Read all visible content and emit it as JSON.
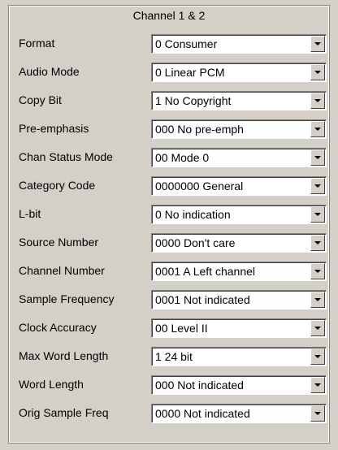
{
  "panel": {
    "title": "Channel 1 & 2",
    "rows": [
      {
        "label": "Format",
        "value": "0  Consumer"
      },
      {
        "label": "Audio Mode",
        "value": "0  Linear PCM"
      },
      {
        "label": "Copy Bit",
        "value": "1  No Copyright"
      },
      {
        "label": "Pre-emphasis",
        "value": "000  No pre-emph"
      },
      {
        "label": "Chan Status Mode",
        "value": "00  Mode 0"
      },
      {
        "label": "Category Code",
        "value": "0000000  General"
      },
      {
        "label": "L-bit",
        "value": "0  No indication"
      },
      {
        "label": "Source Number",
        "value": "0000  Don't care"
      },
      {
        "label": "Channel Number",
        "value": "0001  A Left channel"
      },
      {
        "label": "Sample Frequency",
        "value": "0001  Not indicated"
      },
      {
        "label": "Clock Accuracy",
        "value": "00  Level II"
      },
      {
        "label": "Max Word Length",
        "value": "1  24 bit"
      },
      {
        "label": "Word Length",
        "value": "000  Not indicated"
      },
      {
        "label": "Orig Sample Freq",
        "value": "0000  Not indicated"
      }
    ]
  },
  "icons": {
    "dropdown": "chevron-down-icon"
  }
}
